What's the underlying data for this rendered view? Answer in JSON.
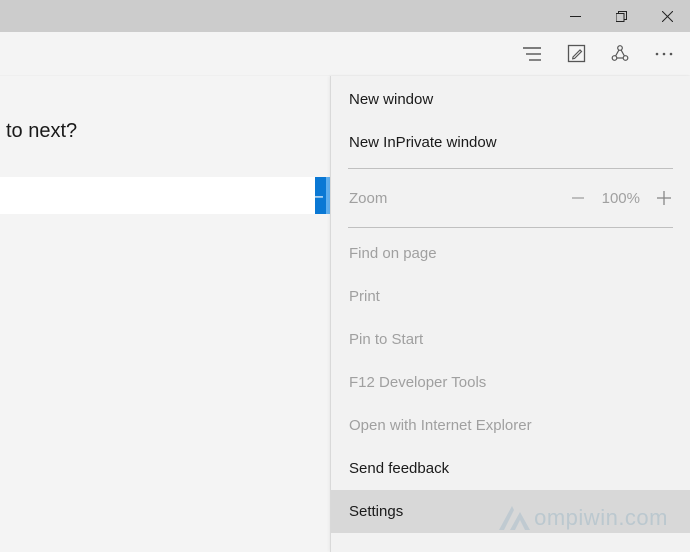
{
  "content": {
    "prompt": "to next?"
  },
  "zoom": {
    "label": "Zoom",
    "level": "100%"
  },
  "menu": {
    "new_window": "New window",
    "new_inprivate": "New InPrivate window",
    "find": "Find on page",
    "print": "Print",
    "pin": "Pin to Start",
    "devtools": "F12 Developer Tools",
    "open_ie": "Open with Internet Explorer",
    "feedback": "Send feedback",
    "settings": "Settings"
  },
  "watermark": {
    "text": "ompiwin.com"
  }
}
